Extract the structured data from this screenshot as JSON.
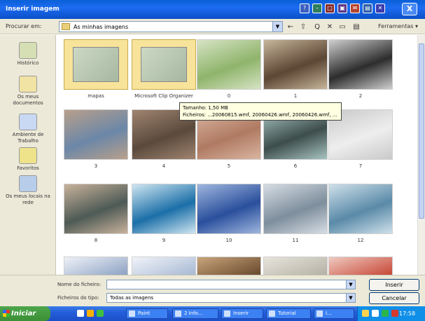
{
  "window": {
    "title": "Inserir imagem",
    "close_label": "X",
    "title_buttons": [
      "?",
      "–",
      "□",
      "▣",
      "✉",
      "▤",
      "✕"
    ]
  },
  "toolbar": {
    "lookin_label": "Procurar em:",
    "folder": "As minhas imagens",
    "combo_arrow": "▼",
    "tools_label": "Ferramentas ▾",
    "icons": [
      "back-icon",
      "up-folder-icon",
      "search-web-icon",
      "delete-icon",
      "new-folder-icon",
      "views-icon"
    ],
    "icon_glyphs": [
      "←",
      "⇧",
      "Q",
      "✕",
      "▭",
      "▤"
    ]
  },
  "places": [
    {
      "label": "Histórico",
      "icon": "history-icon",
      "color": "#d6dfb4"
    },
    {
      "label": "Os meus documentos",
      "icon": "my-documents-icon",
      "color": "#f1e3a4"
    },
    {
      "label": "Ambiente de Trabalho",
      "icon": "desktop-icon",
      "color": "#c9d8f3"
    },
    {
      "label": "Favoritos",
      "icon": "favorites-icon",
      "color": "#eee28a"
    },
    {
      "label": "Os meus locais na rede",
      "icon": "network-places-icon",
      "color": "#b7cde9"
    }
  ],
  "thumbnails": [
    {
      "caption": "mapas",
      "kind": "folder"
    },
    {
      "caption": "Microsoft Clip Organizer",
      "kind": "folder"
    },
    {
      "caption": "0",
      "kind": "image",
      "colors": [
        "#8fb46b",
        "#d6e3c4"
      ]
    },
    {
      "caption": "1",
      "kind": "image",
      "colors": [
        "#5c4634",
        "#c7b59a"
      ]
    },
    {
      "caption": "2",
      "kind": "image",
      "colors": [
        "#2d2d2d",
        "#cfcfcf"
      ]
    },
    {
      "caption": "3",
      "kind": "image",
      "colors": [
        "#6b87a8",
        "#b9a08b"
      ]
    },
    {
      "caption": "4",
      "kind": "image",
      "colors": [
        "#5a4a3c",
        "#a08470"
      ]
    },
    {
      "caption": "5",
      "kind": "image",
      "colors": [
        "#b07a62",
        "#d9b5a1"
      ]
    },
    {
      "caption": "6",
      "kind": "image",
      "colors": [
        "#3d4d4b",
        "#a7c4c2"
      ]
    },
    {
      "caption": "7",
      "kind": "image",
      "colors": [
        "#eeeeee",
        "#c9c9c9"
      ]
    },
    {
      "caption": "8",
      "kind": "image",
      "colors": [
        "#4d5a55",
        "#c9b29b"
      ]
    },
    {
      "caption": "9",
      "kind": "image",
      "colors": [
        "#1b6fa8",
        "#cfe6f1"
      ]
    },
    {
      "caption": "10",
      "kind": "image",
      "colors": [
        "#2a4f9c",
        "#9fb6de"
      ]
    },
    {
      "caption": "11",
      "kind": "image",
      "colors": [
        "#7e8e9c",
        "#d6dde4"
      ]
    },
    {
      "caption": "12",
      "kind": "image",
      "colors": [
        "#5a8aa8",
        "#cfe0ea"
      ]
    },
    {
      "caption": "",
      "kind": "image",
      "colors": [
        "#8fa3c4",
        "#eef2f8"
      ]
    },
    {
      "caption": "",
      "kind": "image",
      "colors": [
        "#a9bad4",
        "#f1f4f9"
      ]
    },
    {
      "caption": "",
      "kind": "image",
      "colors": [
        "#6a4a2e",
        "#c9a57c"
      ]
    },
    {
      "caption": "",
      "kind": "image",
      "colors": [
        "#b6b2a6",
        "#e7e4dc"
      ]
    },
    {
      "caption": "",
      "kind": "image",
      "colors": [
        "#c74a3a",
        "#f0c9bf"
      ]
    }
  ],
  "tooltip": {
    "line1": "Tamanho: 1,50 MB",
    "line2": "Ficheiros: ...20060815.wmf, 20060426.wmf, 20060426.wmf, ..."
  },
  "bottom": {
    "filename_label": "Nome do ficheiro:",
    "filename_value": "",
    "filetype_label": "Ficheiros do tipo:",
    "filetype_value": "Todas as imagens",
    "insert_label": "Inserir",
    "cancel_label": "Cancelar"
  },
  "taskbar": {
    "start_label": "Iniciar",
    "tasks": [
      "Paint",
      "2 Info...",
      "Inserir",
      "Tutorial",
      "I..."
    ],
    "clock": "17:58"
  }
}
